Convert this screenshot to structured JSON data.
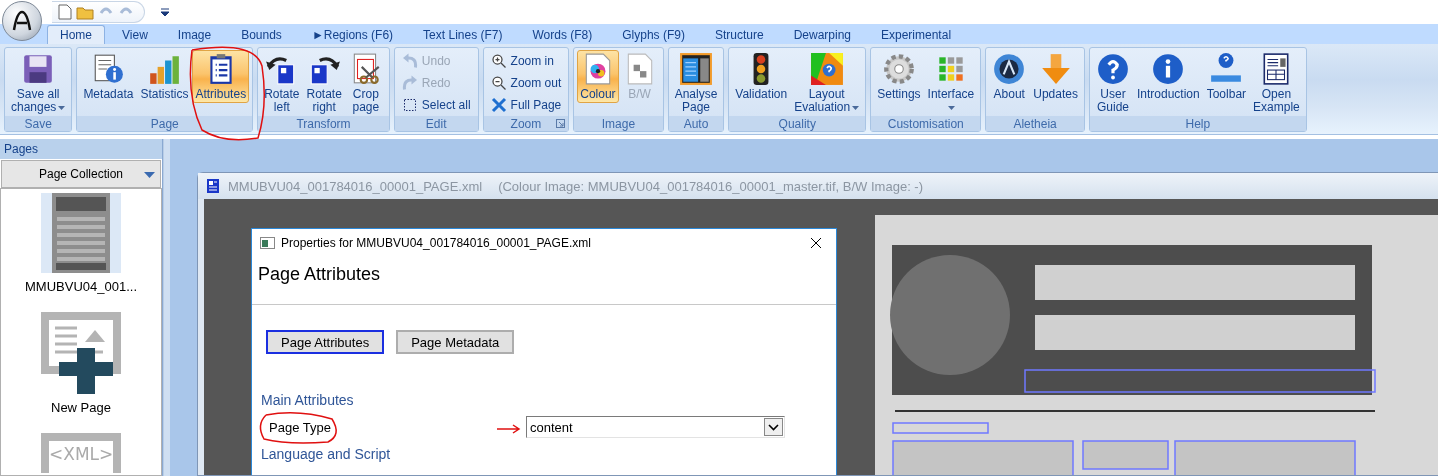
{
  "ribbon": {
    "tabs": [
      {
        "label": "Home",
        "selected": true
      },
      {
        "label": "View",
        "selected": false
      },
      {
        "label": "Image",
        "selected": false
      },
      {
        "label": "Bounds",
        "selected": false
      },
      {
        "label": "►Regions (F6)",
        "selected": false
      },
      {
        "label": "Text Lines (F7)",
        "selected": false
      },
      {
        "label": "Words (F8)",
        "selected": false
      },
      {
        "label": "Glyphs (F9)",
        "selected": false
      },
      {
        "label": "Structure",
        "selected": false
      },
      {
        "label": "Dewarping",
        "selected": false
      },
      {
        "label": "Experimental",
        "selected": false
      }
    ],
    "groups": [
      {
        "label": "Save",
        "kind": "large",
        "buttons": [
          {
            "label": [
              "Save all",
              "changes"
            ],
            "selected": false,
            "dropdown": true
          }
        ]
      },
      {
        "label": "Page",
        "kind": "large",
        "buttons": [
          {
            "label": [
              "Metadata"
            ],
            "selected": false
          },
          {
            "label": [
              "Statistics"
            ],
            "selected": false
          },
          {
            "label": [
              "Attributes"
            ],
            "selected": true
          }
        ]
      },
      {
        "label": "Transform",
        "kind": "large",
        "buttons": [
          {
            "label": [
              "Rotate",
              "left"
            ],
            "selected": false
          },
          {
            "label": [
              "Rotate",
              "right"
            ],
            "selected": false
          },
          {
            "label": [
              "Crop",
              "page"
            ],
            "selected": false
          }
        ]
      },
      {
        "label": "Edit",
        "kind": "small",
        "buttons": [
          {
            "label": [
              "Undo"
            ],
            "selected": false,
            "disabled": true
          },
          {
            "label": [
              "Redo"
            ],
            "selected": false,
            "disabled": true
          },
          {
            "label": [
              "Select all"
            ],
            "selected": false
          }
        ]
      },
      {
        "label": "Zoom",
        "kind": "small",
        "launcher": true,
        "buttons": [
          {
            "label": [
              "Zoom in"
            ],
            "selected": false
          },
          {
            "label": [
              "Zoom out"
            ],
            "selected": false
          },
          {
            "label": [
              "Full Page"
            ],
            "selected": false
          }
        ]
      },
      {
        "label": "Image",
        "kind": "large",
        "buttons": [
          {
            "label": [
              "Colour"
            ],
            "selected": true
          },
          {
            "label": [
              "B/W"
            ],
            "selected": false,
            "disabled": true
          }
        ]
      },
      {
        "label": "Auto",
        "kind": "large",
        "buttons": [
          {
            "label": [
              "Analyse",
              "Page"
            ],
            "selected": false
          }
        ]
      },
      {
        "label": "Quality",
        "kind": "large",
        "buttons": [
          {
            "label": [
              "Validation"
            ],
            "selected": false
          },
          {
            "label": [
              "Layout",
              "Evaluation"
            ],
            "selected": false,
            "dropdown": true
          }
        ]
      },
      {
        "label": "Customisation",
        "kind": "large",
        "buttons": [
          {
            "label": [
              "Settings"
            ],
            "selected": false
          },
          {
            "label": [
              "Interface"
            ],
            "selected": false,
            "dropdown": true
          }
        ]
      },
      {
        "label": "Aletheia",
        "kind": "large",
        "buttons": [
          {
            "label": [
              "About"
            ],
            "selected": false
          },
          {
            "label": [
              "Updates"
            ],
            "selected": false
          }
        ]
      },
      {
        "label": "Help",
        "kind": "large",
        "buttons": [
          {
            "label": [
              "User",
              "Guide"
            ],
            "selected": false
          },
          {
            "label": [
              "Introduction"
            ],
            "selected": false
          },
          {
            "label": [
              "Toolbar"
            ],
            "selected": false
          },
          {
            "label": [
              "Open",
              "Example"
            ],
            "selected": false
          }
        ]
      }
    ]
  },
  "pages_panel": {
    "title": "Pages",
    "collection": "Page Collection",
    "items": [
      {
        "kind": "page",
        "label": "MMUBVU04_001...",
        "selected": true
      },
      {
        "kind": "new",
        "label": "New Page",
        "selected": false
      },
      {
        "kind": "xml",
        "icon_text": "<XML>",
        "selected": false
      }
    ]
  },
  "document": {
    "title": "MMUBVU04_001784016_00001_PAGE.xml",
    "info": "(Colour Image: MMUBVU04_001784016_00001_master.tif,  B/W Image: -)"
  },
  "dialog": {
    "title": "Properties for MMUBVU04_001784016_00001_PAGE.xml",
    "heading": "Page Attributes",
    "tabs": [
      {
        "label": "Page Attributes",
        "selected": true
      },
      {
        "label": "Page Metadata",
        "selected": false
      }
    ],
    "sections": [
      {
        "heading": "Main Attributes",
        "fields": [
          {
            "label": "Page Type",
            "value": "content"
          }
        ]
      },
      {
        "heading": "Language and Script"
      }
    ]
  }
}
